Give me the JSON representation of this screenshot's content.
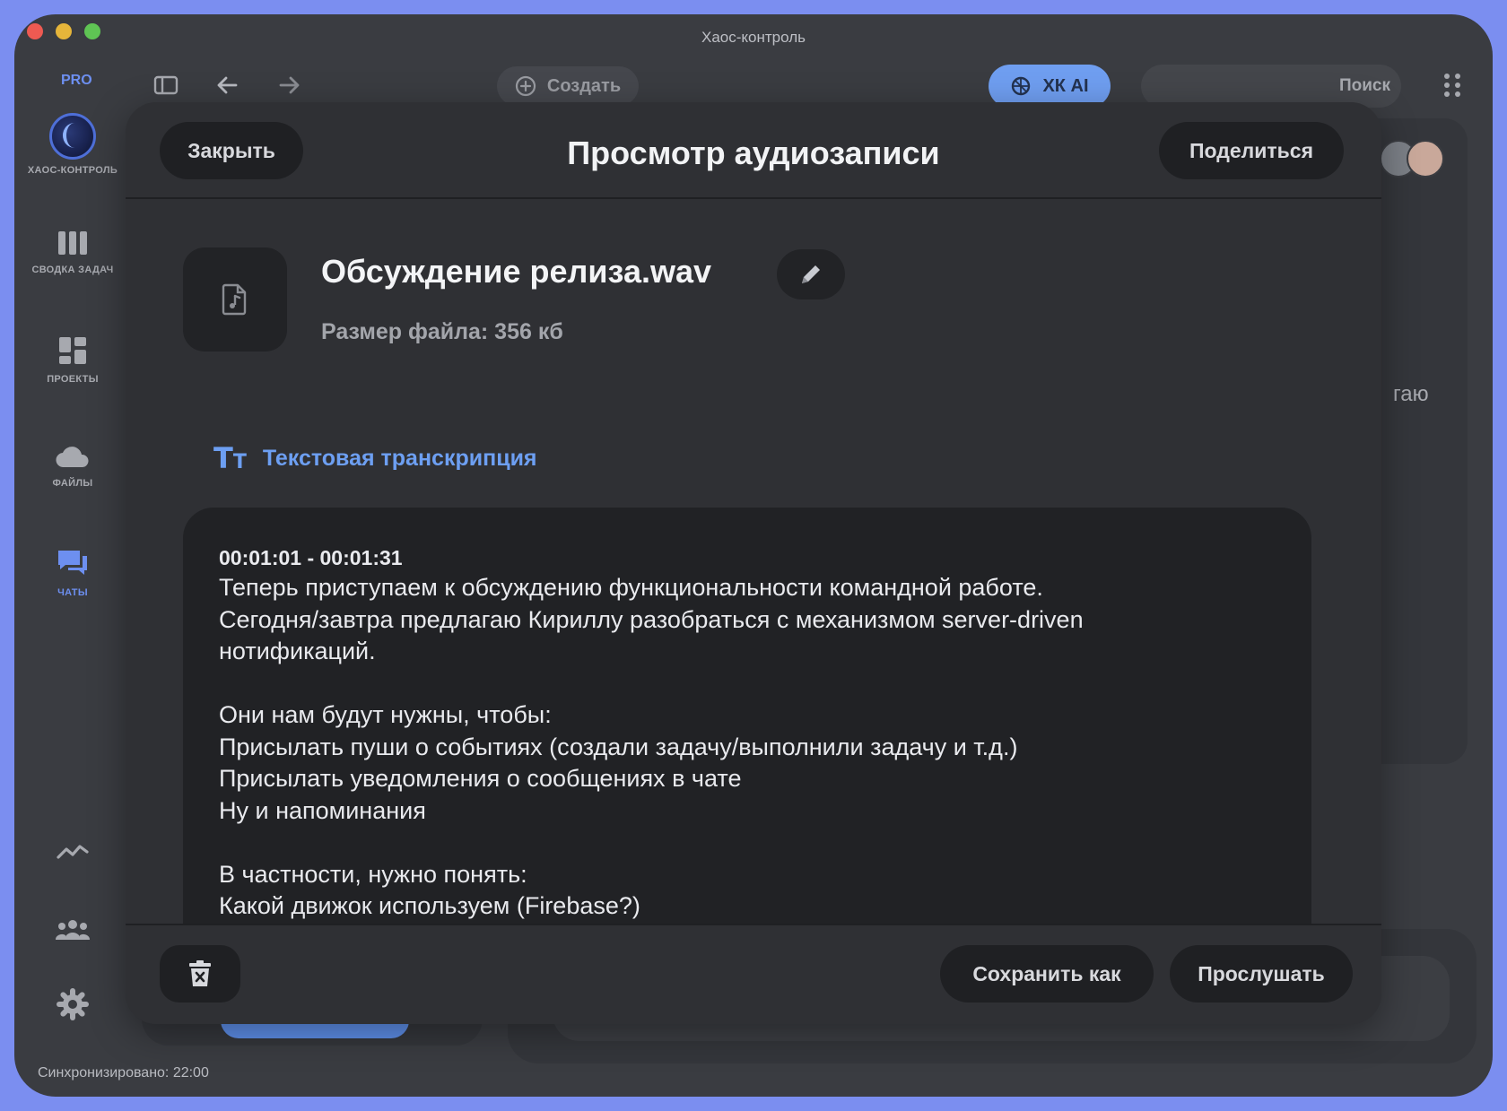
{
  "window": {
    "title": "Хаос-контроль"
  },
  "toolbar": {
    "pro_badge": "PRO",
    "create_label": "Создать",
    "ai_label": "ХК AI",
    "search_placeholder": "Поиск"
  },
  "sidebar": {
    "items": [
      {
        "label": "ХАОС-КОНТРОЛЬ",
        "icon": "app-logo-icon"
      },
      {
        "label": "СВОДКА ЗАДАЧ",
        "icon": "columns-icon"
      },
      {
        "label": "ПРОЕКТЫ",
        "icon": "dashboard-icon"
      },
      {
        "label": "ФАЙЛЫ",
        "icon": "cloud-icon"
      },
      {
        "label": "ЧАТЫ",
        "icon": "chat-icon",
        "active": true
      }
    ],
    "bottom_icons": [
      "analytics-icon",
      "team-icon",
      "settings-icon"
    ],
    "sync_status": "Синхронизировано: 22:00"
  },
  "background": {
    "partial_text": "гаю"
  },
  "modal": {
    "title": "Просмотр аудиозаписи",
    "close_label": "Закрыть",
    "share_label": "Поделиться",
    "file": {
      "name": "Обсуждение релиза.wav",
      "size_text": "Размер файла: 356 кб",
      "icon": "audio-file-icon"
    },
    "transcription": {
      "section_title": "Текстовая транскрипция",
      "timestamp": "00:01:01 - 00:01:31",
      "lines": [
        "Теперь приступаем к обсуждению функциональности командной работе.",
        "Сегодня/завтра предлагаю Кириллу разобраться с механизмом server-driven",
        "нотификаций.",
        "",
        "Они нам будут нужны, чтобы:",
        "Присылать пуши о событиях (создали задачу/выполнили задачу и т.д.)",
        "Присылать уведомления о сообщениях в чате",
        "Ну и напоминания",
        "",
        "В частности, нужно понять:",
        "Какой движок используем (Firebase?)"
      ]
    },
    "footer": {
      "save_as_label": "Сохранить как",
      "listen_label": "Прослушать"
    }
  },
  "colors": {
    "accent": "#6d9ff2",
    "frame": "#7b8ef0",
    "window_bg": "#3a3c41",
    "modal_bg": "#2f3034",
    "transcript_bg": "#212225"
  }
}
